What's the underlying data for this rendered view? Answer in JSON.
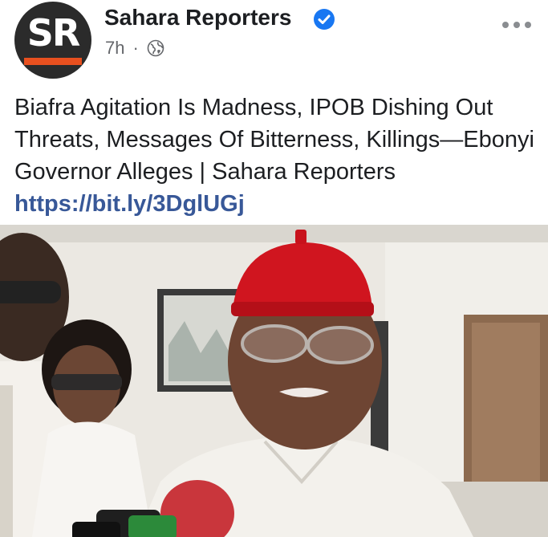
{
  "post": {
    "avatar": {
      "initials": "SR",
      "accent_color": "#e8501f"
    },
    "page_name": "Sahara Reporters",
    "verified_icon": "verified-badge-icon",
    "timestamp": "7h",
    "separator": "·",
    "audience_icon": "globe-icon",
    "more_icon": "more-options-icon",
    "text": "Biafra Agitation Is Madness, IPOB Dishing Out Threats, Messages Of Bitterness, Killings—Ebonyi Governor Alleges | Sahara Reporters",
    "link": "https://bit.ly/3DglUGj",
    "link_color": "#385898"
  }
}
